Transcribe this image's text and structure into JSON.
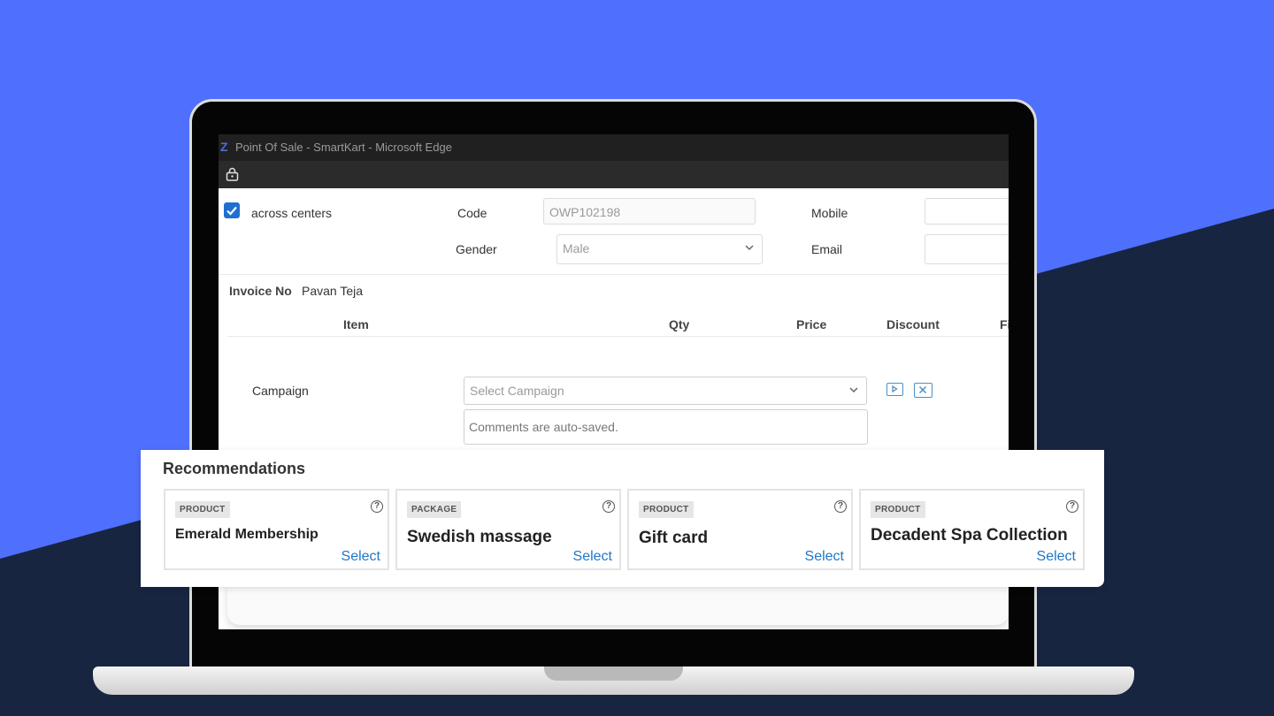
{
  "window": {
    "title": "Point Of Sale - SmartKart - Microsoft Edge"
  },
  "customer": {
    "across_centers_label": "across centers",
    "across_centers_checked": true,
    "code_label": "Code",
    "code_value": "OWP102198",
    "mobile_label": "Mobile",
    "mobile_value": "",
    "gender_label": "Gender",
    "gender_value": "Male",
    "email_label": "Email",
    "email_value": ""
  },
  "invoice": {
    "label": "Invoice No",
    "value": "Pavan Teja"
  },
  "table": {
    "headers": [
      "Item",
      "Qty",
      "Price",
      "Discount",
      "Fi"
    ]
  },
  "campaign": {
    "label": "Campaign",
    "placeholder": "Select Campaign",
    "comments_placeholder": "Comments are auto-saved."
  },
  "recommendations": {
    "title": "Recommendations",
    "select_label": "Select",
    "items": [
      {
        "type": "PRODUCT",
        "name": "Emerald Membership"
      },
      {
        "type": "PACKAGE",
        "name": "Swedish massage"
      },
      {
        "type": "PRODUCT",
        "name": "Gift card"
      },
      {
        "type": "PRODUCT",
        "name": "Decadent Spa Collection"
      }
    ]
  },
  "icons": {
    "lock": "lock-icon",
    "checkbox": "check-icon",
    "dropdown": "chevron-down-icon",
    "play": "play-icon",
    "close": "close-icon",
    "help": "help-circle-icon"
  },
  "colors": {
    "background_blue": "#4f6ffd",
    "background_navy": "#172540",
    "accent_blue": "#1f6fd1",
    "select_link": "#1f76c9"
  }
}
